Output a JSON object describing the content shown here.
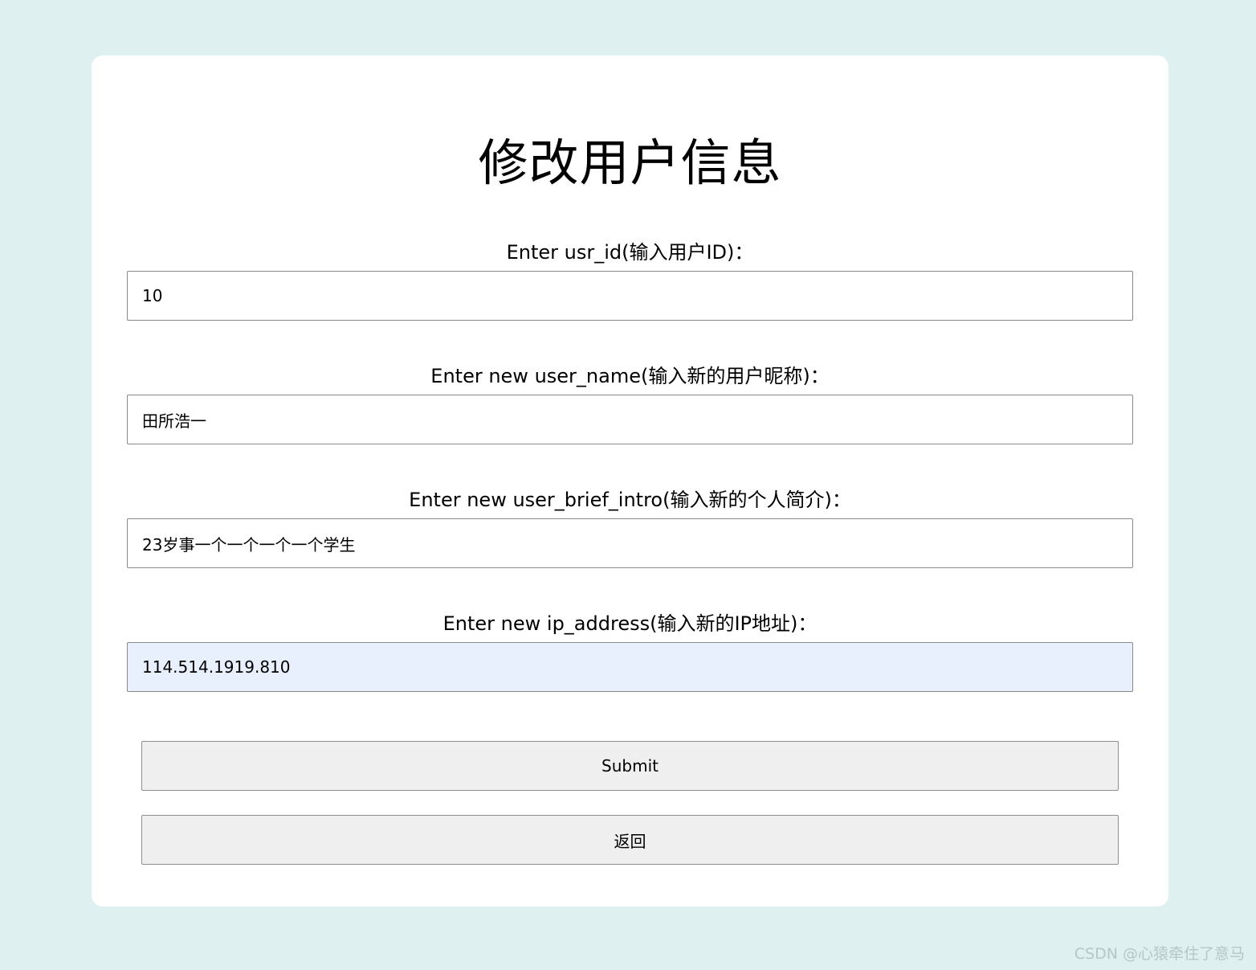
{
  "page": {
    "title": "修改用户信息"
  },
  "form": {
    "usr_id": {
      "label": "Enter usr_id(输入用户ID)：",
      "value": "10"
    },
    "user_name": {
      "label": "Enter new user_name(输入新的用户昵称)：",
      "value": "田所浩一"
    },
    "user_brief_intro": {
      "label": "Enter new user_brief_intro(输入新的个人简介)：",
      "value": "23岁事一个一个一个一个学生"
    },
    "ip_address": {
      "label": "Enter new ip_address(输入新的IP地址)：",
      "value": "114.514.1919.810"
    }
  },
  "buttons": {
    "submit_label": "Submit",
    "back_label": "返回"
  },
  "watermark": "CSDN @心猿牵住了意马",
  "colors": {
    "page_background": "#dff0f0",
    "card_background": "#ffffff",
    "autofill_background": "#e8f0fe",
    "button_background": "#efefef"
  }
}
